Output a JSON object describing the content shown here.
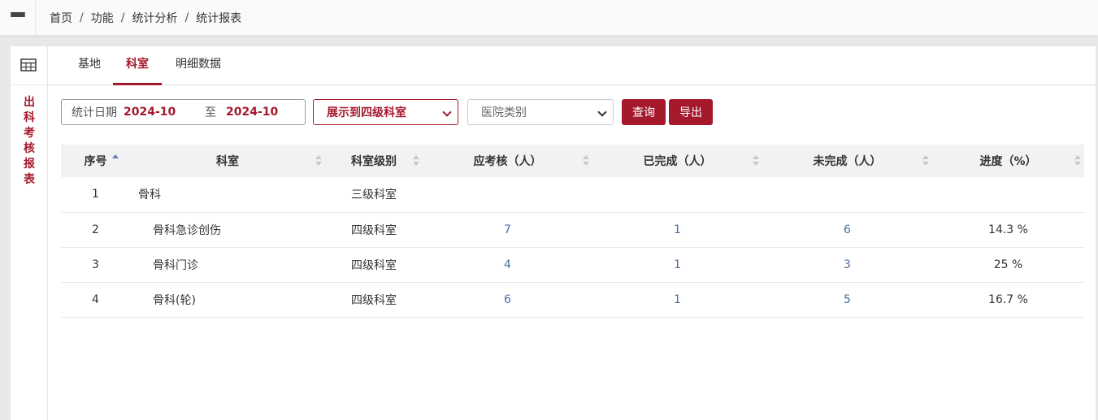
{
  "breadcrumb": [
    "首页",
    "功能",
    "统计分析",
    "统计报表"
  ],
  "sidebar_title": [
    "出",
    "科",
    "考",
    "核",
    "报",
    "表"
  ],
  "tabs": [
    {
      "label": "基地",
      "active": false
    },
    {
      "label": "科室",
      "active": true
    },
    {
      "label": "明细数据",
      "active": false
    }
  ],
  "filters": {
    "date_label": "统计日期",
    "date_from": "2024-10",
    "date_to_label": "至",
    "date_to": "2024-10",
    "level_select": "展示到四级科室",
    "hospital_select": "医院类别",
    "query_button": "查询",
    "export_button": "导出"
  },
  "table": {
    "columns": [
      "序号",
      "科室",
      "科室级别",
      "应考核（人）",
      "已完成（人）",
      "未完成（人）",
      "进度（%）"
    ],
    "rows": [
      {
        "no": "1",
        "dept": "骨科",
        "level": "三级科室",
        "required": "",
        "completed": "",
        "pending": "",
        "progress": ""
      },
      {
        "no": "2",
        "dept": "骨科急诊创伤",
        "level": "四级科室",
        "required": "7",
        "completed": "1",
        "pending": "6",
        "progress": "14.3 %"
      },
      {
        "no": "3",
        "dept": "骨科门诊",
        "level": "四级科室",
        "required": "4",
        "completed": "1",
        "pending": "3",
        "progress": "25 %"
      },
      {
        "no": "4",
        "dept": "骨科(轮)",
        "level": "四级科室",
        "required": "6",
        "completed": "1",
        "pending": "5",
        "progress": "16.7 %"
      }
    ]
  },
  "colors": {
    "accent": "#a5192d",
    "link": "#4a6fa5"
  },
  "icons": {
    "menu": "hamburger-menu-icon",
    "table": "table-grid-icon",
    "sort": "sort-icon",
    "dropdown": "chevron-down-icon"
  }
}
